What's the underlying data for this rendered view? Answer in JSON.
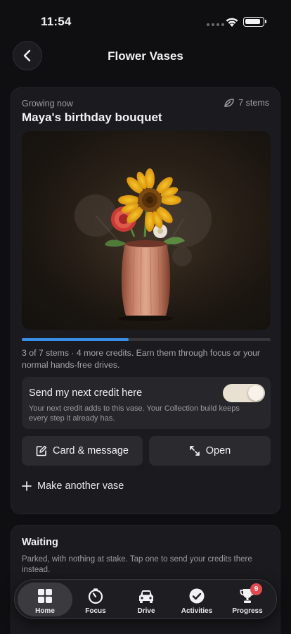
{
  "status_bar": {
    "time": "11:54"
  },
  "header": {
    "title": "Flower Vases"
  },
  "vase_card": {
    "eyebrow": "Growing now",
    "stems_count": "7 stems",
    "title": "Maya's birthday bouquet",
    "progress": 0.43,
    "progress_text": "3 of 7 stems · 4 more credits. Earn them through focus or your normal hands-free drives.",
    "credit_panel": {
      "title": "Send my next credit here",
      "description": "Your next credit adds to this vase. Your Collection build keeps every step it already has.",
      "toggle_on": true
    },
    "buttons": {
      "card_message": "Card & message",
      "open": "Open"
    },
    "add_vase": "Make another vase"
  },
  "waiting_card": {
    "title": "Waiting",
    "description": "Parked, with nothing at stake. Tap one to send your credits there instead."
  },
  "tab_bar": {
    "tabs": [
      {
        "label": "Home",
        "icon": "grid-icon",
        "active": true
      },
      {
        "label": "Focus",
        "icon": "timer-icon"
      },
      {
        "label": "Drive",
        "icon": "car-icon"
      },
      {
        "label": "Activities",
        "icon": "check-circle-icon"
      },
      {
        "label": "Progress",
        "icon": "trophy-icon",
        "badge": "9"
      }
    ]
  },
  "colors": {
    "accent": "#3a8ee6",
    "badge": "#e5484d",
    "toggle_on": "#e8e0d0"
  }
}
